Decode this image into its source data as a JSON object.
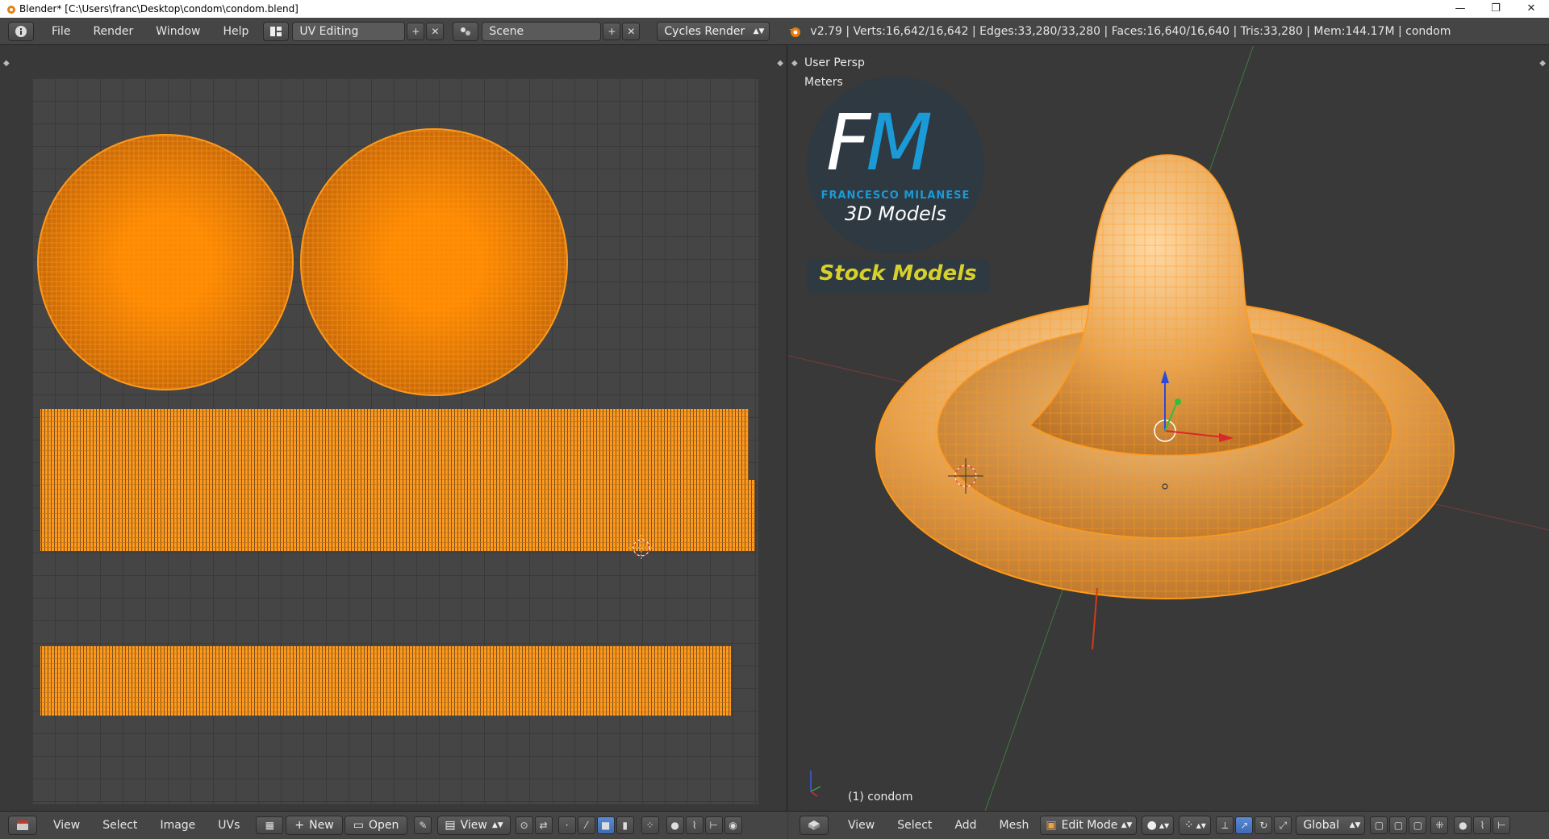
{
  "window": {
    "title": "Blender* [C:\\Users\\franc\\Desktop\\condom\\condom.blend]",
    "minimize": "—",
    "maximize": "❐",
    "close": "✕"
  },
  "infobar": {
    "menus": [
      "File",
      "Render",
      "Window",
      "Help"
    ],
    "layout": "UV Editing",
    "scene": "Scene",
    "engine": "Cycles Render",
    "stats": "v2.79 | Verts:16,642/16,642 | Edges:33,280/33,280 | Faces:16,640/16,640 | Tris:33,280 | Mem:144.17M | condom"
  },
  "viewport": {
    "view_name": "User Persp",
    "units": "Meters",
    "object_label": "(1) condom",
    "logo": {
      "letters": "FM",
      "name": "FRANCESCO MILANESE",
      "subtitle": "3D Models",
      "banner": "Stock Models"
    },
    "colors": {
      "mesh": "#e8a350",
      "wire": "#ff9a1a",
      "accent": "#1a9ad6",
      "banner_text": "#d8d02a"
    }
  },
  "uv_footer": {
    "menus": [
      "View",
      "Select",
      "Image",
      "UVs"
    ],
    "new_label": "New",
    "open_label": "Open",
    "view_label": "View"
  },
  "viewport_footer": {
    "menus": [
      "View",
      "Select",
      "Add",
      "Mesh"
    ],
    "mode": "Edit Mode",
    "orientation": "Global"
  }
}
